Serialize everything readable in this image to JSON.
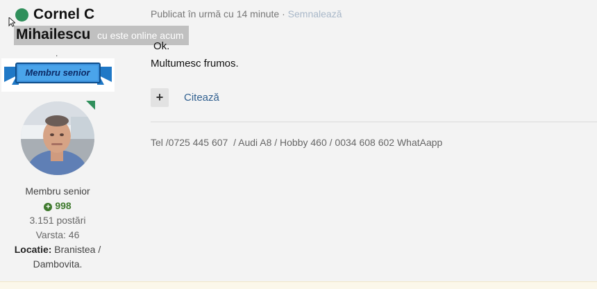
{
  "author": {
    "first_name": "Cornel C",
    "last_name": "Mihailescu",
    "online_tooltip": "cu este online acum",
    "dot": ".",
    "rank_badge": "Membru senior",
    "rank": "Membru senior",
    "reputation": "998",
    "posts": "3.151 postări",
    "age": "Varsta: 46",
    "location_label": "Locatie:",
    "location_value_1": " Branistea /",
    "location_value_2": "Dambovita."
  },
  "post": {
    "meta": "Publicat în urmă cu 14 minute · ",
    "report": "Semnalează",
    "lines": [
      "Ok.",
      "Multumesc frumos."
    ],
    "plus_label": "+",
    "quote_label": "Citează",
    "signature": "Tel /0725 445 607  / Audi A8 / Hobby 460 / 0034 608 602 WhatAapp"
  },
  "colors": {
    "online": "#2f8f5b",
    "reputation": "#3f7a2e",
    "link": "#2f5f8f"
  },
  "icons": {
    "online_status": "online-dot-icon",
    "cursor": "cursor-icon",
    "reputation": "plus-circle-icon",
    "avatar_online": "online-corner-icon"
  }
}
